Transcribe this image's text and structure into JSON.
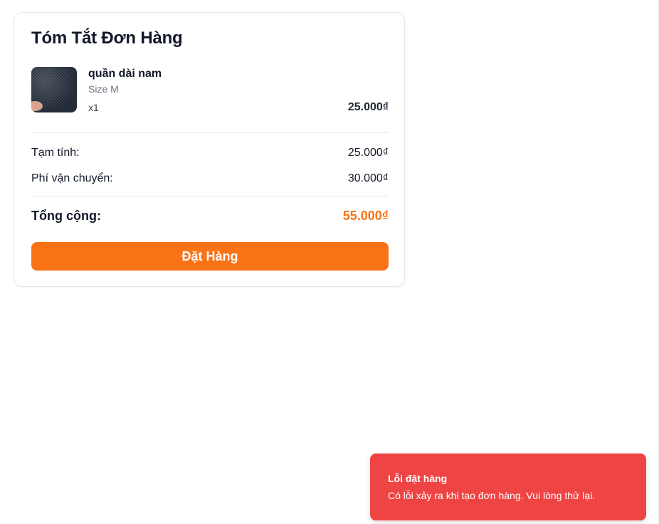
{
  "order_summary": {
    "title": "Tóm Tắt Đơn Hàng",
    "items": [
      {
        "name": "quần dài nam",
        "variant": "Size M",
        "quantity": "x1",
        "price": "25.000₫"
      }
    ],
    "subtotal_label": "Tạm tính:",
    "subtotal_value": "25.000₫",
    "shipping_label": "Phí vận chuyển:",
    "shipping_value": "30.000₫",
    "total_label": "Tổng cộng:",
    "total_value": "55.000₫",
    "place_order_label": "Đặt Hàng"
  },
  "toast": {
    "title": "Lỗi đặt hàng",
    "message": "Có lỗi xảy ra khi tạo đơn hàng. Vui lòng thử lại."
  },
  "colors": {
    "accent": "#f97316",
    "error": "#ef4444",
    "text": "#111827",
    "muted": "#6b7280",
    "border": "#e5e7eb"
  },
  "icons": {
    "product_image": "product-photo-pants"
  }
}
